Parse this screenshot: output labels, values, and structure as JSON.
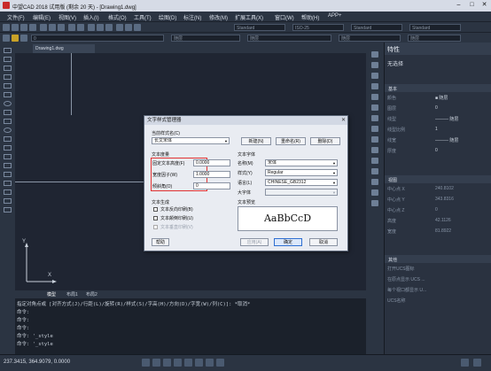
{
  "window": {
    "title": "中望CAD 2018 试用版 (剩余 20 天) - [Drawing1.dwg]"
  },
  "menu": [
    "文件(F)",
    "编辑(E)",
    "视图(V)",
    "插入(I)",
    "格式(O)",
    "工具(T)",
    "绘图(D)",
    "标注(N)",
    "修改(M)",
    "扩展工具(X)",
    "窗口(W)",
    "帮助(H)",
    "APP+"
  ],
  "toolbar": {
    "style1": "Standard",
    "style2": "ISO-25",
    "style3": "Standard",
    "style4": "Standard",
    "layer": "随层",
    "linetype": "随层",
    "lineweight": "随层",
    "color": "随层",
    "layer_combo": "0"
  },
  "doc_tab": "Drawing1.dwg",
  "layout_tabs": [
    "模型",
    "布局1",
    "布局2"
  ],
  "properties": {
    "title": "特性",
    "selection": "无选择",
    "sections": {
      "basic": "基本",
      "view": "视图",
      "other": "其他"
    },
    "basic_rows": [
      {
        "label": "颜色",
        "value": "■ 随层"
      },
      {
        "label": "图层",
        "value": "0"
      },
      {
        "label": "线型",
        "value": "——— 随层"
      },
      {
        "label": "线型比例",
        "value": "1"
      },
      {
        "label": "线宽",
        "value": "——— 随层"
      },
      {
        "label": "厚度",
        "value": "0"
      }
    ],
    "view_rows": [
      {
        "label": "中心点 X",
        "value": "240.8102"
      },
      {
        "label": "中心点 Y",
        "value": "343.8316"
      },
      {
        "label": "中心点 Z",
        "value": "0"
      },
      {
        "label": "高度",
        "value": "42.1126"
      },
      {
        "label": "宽度",
        "value": "81.8922"
      }
    ],
    "other_rows": [
      {
        "label": "打开UCS图标",
        "value": ""
      },
      {
        "label": "在原点显示 UCS ...",
        "value": ""
      },
      {
        "label": "每个视口都显示 U...",
        "value": ""
      },
      {
        "label": "UCS名称",
        "value": ""
      }
    ]
  },
  "dialog": {
    "title": "文字样式管理器",
    "style_name_label": "当前样式名(C)",
    "style_name_value": "长文宋体",
    "new_btn": "新建(N)",
    "rename_btn": "重命名(R)",
    "delete_btn": "删除(D)",
    "text_measure_label": "文本度量",
    "fixed_height_label": "固定文本高度(F)",
    "fixed_height_value": "0.0000",
    "width_factor_label": "宽度因子(W)",
    "width_factor_value": "1.0000",
    "oblique_label": "倾斜角(O)",
    "oblique_value": "0",
    "text_font_label": "文本字体",
    "name_label": "名称(M)",
    "name_value": "宋体",
    "style_label": "样式(Y)",
    "style_value": "Regular",
    "lang_label": "语言(L)",
    "lang_value": "CHINESE_GB2312",
    "bigfont_label": "大字体",
    "gen_label": "文本生成",
    "backwards_label": "文本反向印刷(B)",
    "upside_label": "文本颠倒印刷(U)",
    "vertical_label": "文本垂直印刷(V)",
    "preview_label": "文本预览",
    "preview_text": "AaBbCcD",
    "help_btn": "帮助",
    "apply_btn": "应用(A)",
    "ok_btn": "确定",
    "cancel_btn": "取消"
  },
  "command": {
    "lines": [
      "指定对角点或 [对齐方式(J)/行距(L)/旋转(R)/样式(S)/字高(H)/方向(D)/字宽(W)/列(C)]: *取消*",
      "命令:",
      "命令:",
      "命令:",
      "命令: '_style",
      "命令: '_style"
    ]
  },
  "status": {
    "coords": "237.3415, 364.9079, 0.0000"
  },
  "ucs": {
    "x": "X",
    "y": "Y"
  }
}
